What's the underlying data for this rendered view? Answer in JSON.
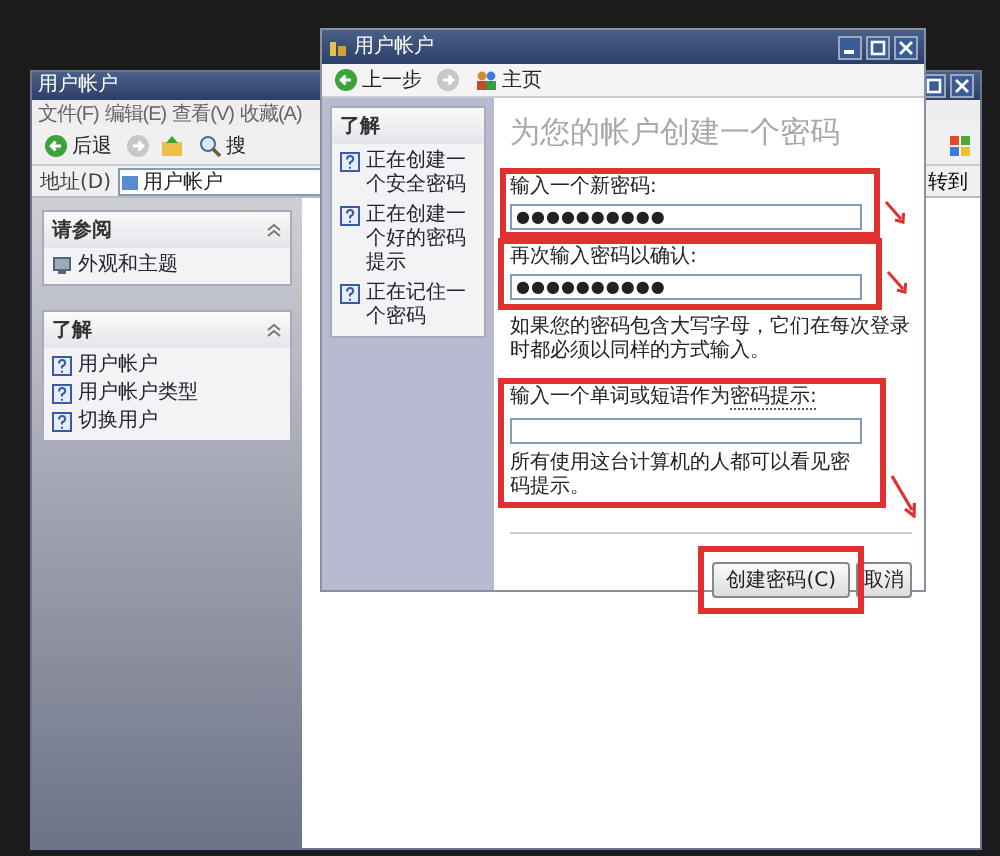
{
  "back_window": {
    "title": "用户帐户",
    "menu": [
      "文件(F)",
      "编辑(E)",
      "查看(V)",
      "收藏(A)"
    ],
    "toolbar": {
      "back": "后退",
      "search": "搜"
    },
    "address": {
      "label": "地址(D)",
      "value": "用户帐户",
      "go": "转到"
    },
    "panels": [
      {
        "title": "请参阅",
        "items": [
          {
            "label": "外观和主题"
          }
        ]
      },
      {
        "title": "了解",
        "items": [
          {
            "label": "用户帐户"
          },
          {
            "label": "用户帐户类型"
          },
          {
            "label": "切换用户"
          }
        ]
      }
    ]
  },
  "front_window": {
    "title": "用户帐户",
    "toolbar": {
      "back": "上一步",
      "home": "主页"
    },
    "learn_panel": {
      "title": "了解",
      "items": [
        {
          "label": "正在创建一个安全密码"
        },
        {
          "label": "正在创建一个好的密码提示"
        },
        {
          "label": "正在记住一个密码"
        }
      ]
    },
    "heading": "为您的帐户创建一个密码",
    "fields": [
      {
        "label": "输入一个新密码:",
        "value": "●●●●●●●●●●"
      },
      {
        "label": "再次输入密码以确认:",
        "value": "●●●●●●●●●●"
      }
    ],
    "note": "如果您的密码包含大写字母，它们在每次登录时都必须以同样的方式输入。",
    "hint": {
      "label": "输入一个单词或短语作为",
      "link": "密码提示:"
    },
    "hint_note": "所有使用这台计算机的人都可以看见密码提示。",
    "buttons": [
      {
        "label": "创建密码(C)",
        "kind": "primary"
      },
      {
        "label": "取消",
        "kind": "cancel"
      }
    ]
  }
}
